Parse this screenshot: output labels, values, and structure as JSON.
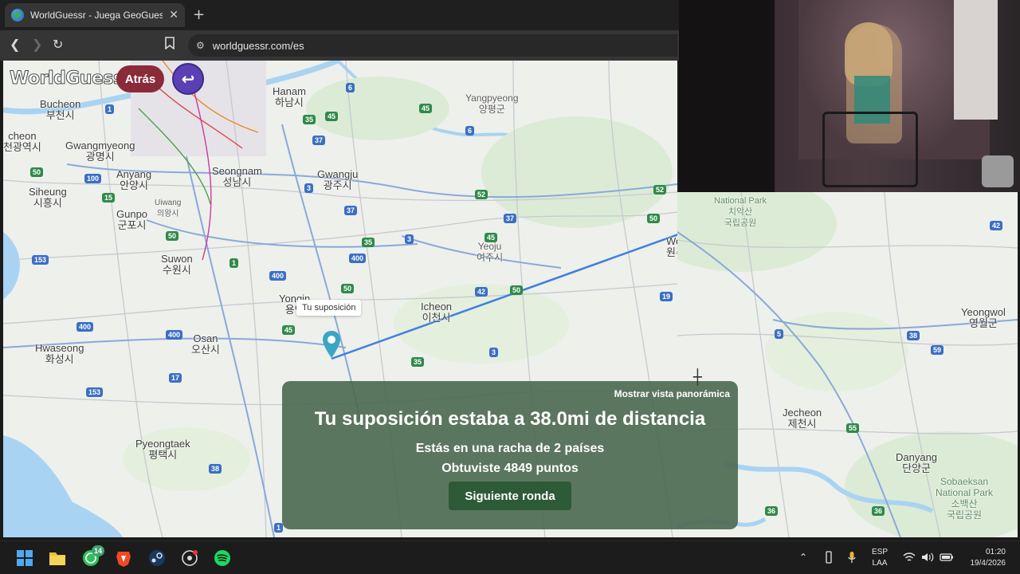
{
  "browser": {
    "tab_title": "WorldGuessr - Juega GeoGuessr",
    "tab_close": "✕",
    "new_tab": "+",
    "url": "worldguessr.com/es"
  },
  "game": {
    "logo": "WorldGuessr",
    "back_label": "Atrás",
    "return_icon": "↩",
    "guess_tooltip": "Tu suposición",
    "result": {
      "panorama_link": "Mostrar vista panorámica",
      "distance_text": "Tu suposición estaba a 38.0mi de distancia",
      "streak_text": "Estás en una racha de 2 países",
      "points_text": "Obtuviste 4849 puntos",
      "next_round": "Siguiente ronda"
    }
  },
  "map_labels": {
    "hanam": "Hanam\n하남시",
    "yangpyeong": "Yangpyeong\n양평군",
    "bucheon": "Bucheon\n부천시",
    "incheon": "cheon\n천광역시",
    "gwangmyeong": "Gwangmyeong\n광명시",
    "seongnam": "Seongnam\n성남시",
    "gwangju": "Gwangju\n광주시",
    "anyang": "Anyang\n안양시",
    "siheung": "Siheung\n시흥시",
    "uiwang": "Uiwang\n의왕시",
    "gunpo": "Gunpo\n군포시",
    "suwon": "Suwon\n수원시",
    "yeoju": "Yeoju\n여주시",
    "wonju": "Wonju\n원주시",
    "yongin": "Yongin\n용인",
    "icheon": "Icheon\n이천시",
    "osan": "Osan\n오산시",
    "hwaseong": "Hwaseong\n화성시",
    "pyeongtaek": "Pyeongtaek\n평택시",
    "national_park": "National Park\n치악산\n국립공원",
    "yeongwol": "Yeongwol\n영월군",
    "jecheon": "Jecheon\n제천시",
    "danyang": "Danyang\n단양군",
    "sobaeksan": "Sobaeksan\nNational Park\n소백산\n국립공원"
  },
  "taskbar": {
    "whatsapp_badge": "14",
    "lang_top": "ESP",
    "lang_bottom": "LAA",
    "time": "01:20",
    "date": "19/4/2026"
  },
  "colors": {
    "result_panel": "#4a6850",
    "next_button": "#2d5a37",
    "back_button": "#8a2b3a",
    "return_button": "#5b3fb5",
    "guess_line": "#3f7fe0",
    "actual_pin": "#e0262f",
    "guess_pin": "#3aa6c4"
  }
}
